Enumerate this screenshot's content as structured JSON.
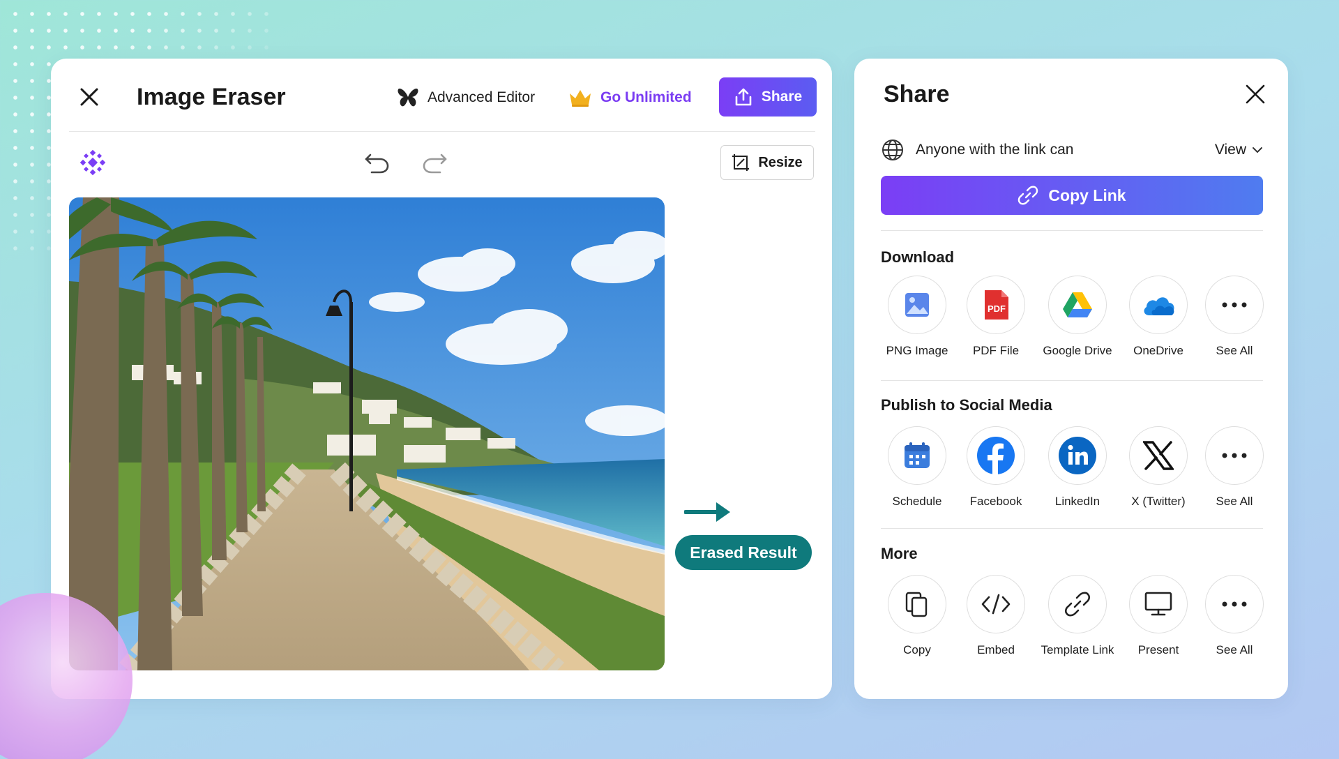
{
  "editor": {
    "title": "Image Eraser",
    "advanced_editor_label": "Advanced Editor",
    "go_unlimited_label": "Go Unlimited",
    "share_label": "Share",
    "resize_label": "Resize",
    "result_badge": "Erased Result"
  },
  "share_panel": {
    "title": "Share",
    "access_text": "Anyone with the link can",
    "access_value": "View",
    "copy_link_label": "Copy Link",
    "sections": {
      "download": {
        "title": "Download",
        "items": [
          {
            "label": "PNG Image",
            "icon": "image-icon"
          },
          {
            "label": "PDF File",
            "icon": "pdf-icon"
          },
          {
            "label": "Google Drive",
            "icon": "google-drive-icon"
          },
          {
            "label": "OneDrive",
            "icon": "onedrive-icon"
          },
          {
            "label": "See All",
            "icon": "more-icon"
          }
        ]
      },
      "social": {
        "title": "Publish to Social Media",
        "items": [
          {
            "label": "Schedule",
            "icon": "calendar-icon"
          },
          {
            "label": "Facebook",
            "icon": "facebook-icon"
          },
          {
            "label": "LinkedIn",
            "icon": "linkedin-icon"
          },
          {
            "label": "X (Twitter)",
            "icon": "x-twitter-icon"
          },
          {
            "label": "See All",
            "icon": "more-icon"
          }
        ]
      },
      "more": {
        "title": "More",
        "items": [
          {
            "label": "Copy",
            "icon": "copy-icon"
          },
          {
            "label": "Embed",
            "icon": "code-icon"
          },
          {
            "label": "Template Link",
            "icon": "link-icon"
          },
          {
            "label": "Present",
            "icon": "monitor-icon"
          },
          {
            "label": "See All",
            "icon": "more-icon"
          }
        ]
      }
    },
    "pdf_badge_text": "PDF"
  },
  "colors": {
    "accent_purple": "#7b3ef5",
    "accent_blue": "#4f7cf0",
    "teal": "#0f7a7c",
    "gold": "#f2b01e"
  }
}
